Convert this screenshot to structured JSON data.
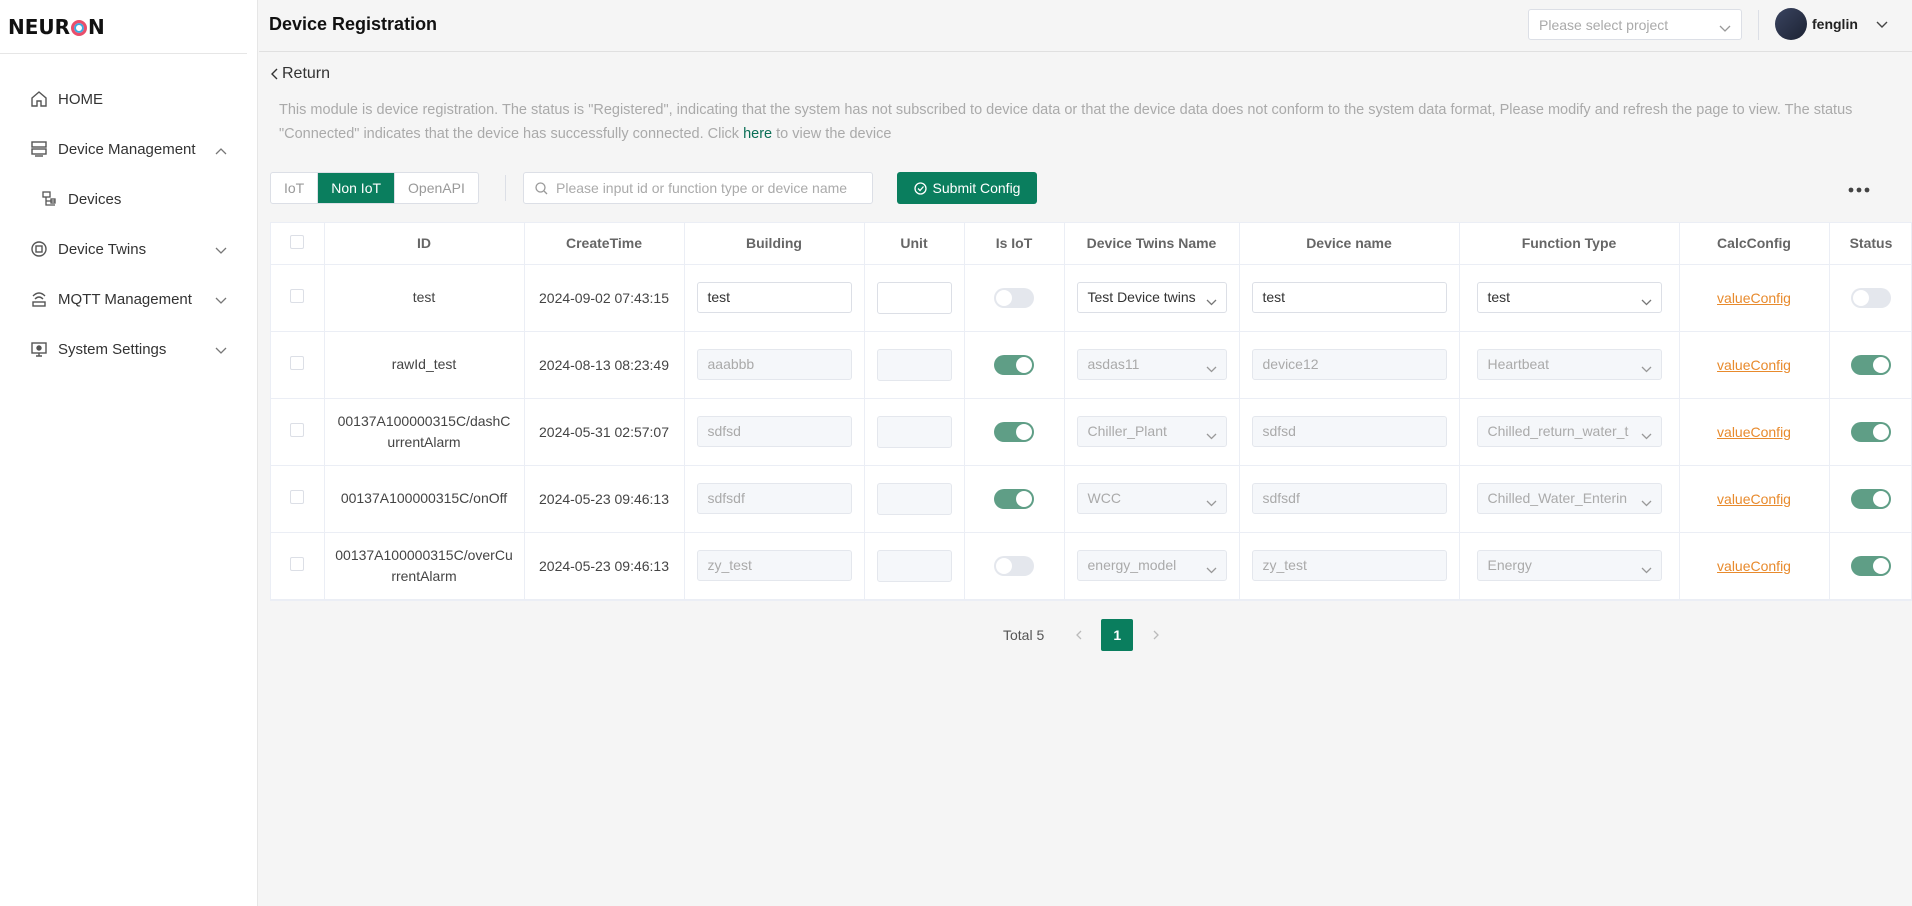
{
  "app": {
    "logo_text_left": "NEUR",
    "logo_text_right": "N"
  },
  "sidebar": {
    "items": [
      {
        "label": "HOME",
        "icon": "home-icon"
      },
      {
        "label": "Device Management",
        "icon": "server-icon",
        "expanded": true
      },
      {
        "label": "Devices",
        "icon": "devices-icon"
      },
      {
        "label": "Device Twins",
        "icon": "twins-icon"
      },
      {
        "label": "MQTT Management",
        "icon": "mqtt-icon"
      },
      {
        "label": "System Settings",
        "icon": "monitor-icon"
      }
    ]
  },
  "header": {
    "title": "Device Registration",
    "project_placeholder": "Please select project",
    "username": "fenglin"
  },
  "content": {
    "return_label": "Return",
    "notice_text": "This module is device registration. The status is \"Registered\", indicating that the system has not subscribed to device data or that the device data does not conform to the system data format, Please modify and refresh the page to view. The status \"Connected\" indicates that the device has successfully connected. Click",
    "notice_link": "here",
    "notice_tail": "to view the device",
    "tabs": [
      "IoT",
      "Non IoT",
      "OpenAPI"
    ],
    "active_tab": "Non IoT",
    "search_placeholder": "Please input id or function type or device name",
    "submit_label": "Submit Config"
  },
  "table": {
    "columns": [
      "",
      "ID",
      "CreateTime",
      "Building",
      "Unit",
      "Is IoT",
      "Device Twins Name",
      "Device name",
      "Function Type",
      "CalcConfig",
      "Status"
    ],
    "rows": [
      {
        "id": "test",
        "create_time": "2024-09-02 07:43:15",
        "building": "test",
        "unit": "",
        "is_iot": false,
        "twins_name": "Test Device twins",
        "device_name": "test",
        "function_type": "test",
        "calc": "valueConfig",
        "status": false,
        "editable": true
      },
      {
        "id": "rawId_test",
        "create_time": "2024-08-13 08:23:49",
        "building": "aaabbb",
        "unit": "",
        "is_iot": true,
        "twins_name": "asdas11",
        "device_name": "device12",
        "function_type": "Heartbeat",
        "calc": "valueConfig",
        "status": true,
        "editable": false
      },
      {
        "id": "00137A100000315C/dashCurrentAlarm",
        "create_time": "2024-05-31 02:57:07",
        "building": "sdfsd",
        "unit": "",
        "is_iot": true,
        "twins_name": "Chiller_Plant",
        "device_name": "sdfsd",
        "function_type": "Chilled_return_water_t",
        "calc": "valueConfig",
        "status": true,
        "editable": false
      },
      {
        "id": "00137A100000315C/onOff",
        "create_time": "2024-05-23 09:46:13",
        "building": "sdfsdf",
        "unit": "",
        "is_iot": true,
        "twins_name": "WCC",
        "device_name": "sdfsdf",
        "function_type": "Chilled_Water_Enterin",
        "calc": "valueConfig",
        "status": true,
        "editable": false
      },
      {
        "id": "00137A100000315C/overCurrentAlarm",
        "create_time": "2024-05-23 09:46:13",
        "building": "zy_test",
        "unit": "",
        "is_iot": false,
        "twins_name": "energy_model",
        "device_name": "zy_test",
        "function_type": "Energy",
        "calc": "valueConfig",
        "status": true,
        "editable": false
      }
    ]
  },
  "pagination": {
    "total_label": "Total 5",
    "current_page": "1"
  },
  "colors": {
    "accent": "#0a7e5e",
    "link": "#e88a2c",
    "toggle_on": "#5f9e86"
  }
}
